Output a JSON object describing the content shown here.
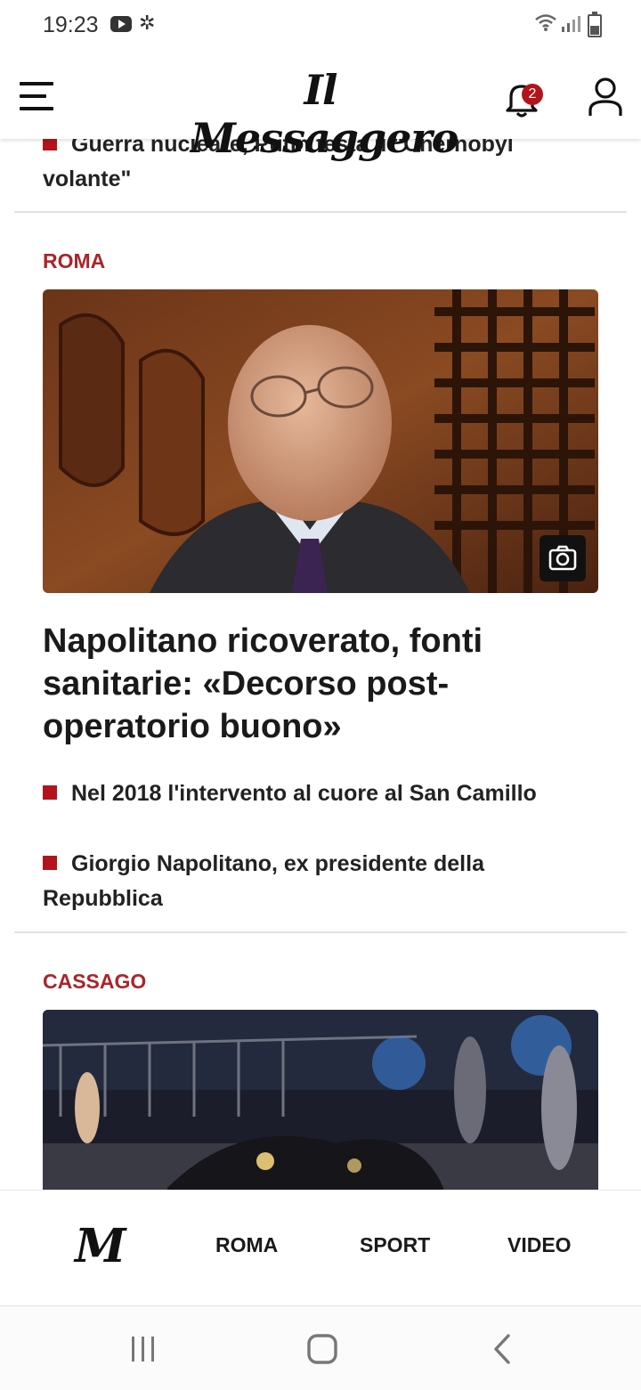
{
  "status_bar": {
    "time": "19:23"
  },
  "header": {
    "logo": "Il Messaggero",
    "notification_count": "2"
  },
  "articles": [
    {
      "bullets": [
        "Guerra nucleare, Putin testa il \"Chernobyl volante\""
      ]
    },
    {
      "section": "ROMA",
      "headline": "Napolitano ricoverato, fonti sanitarie: «Decorso post-operatorio buono»",
      "bullets": [
        "Nel 2018 l'intervento al cuore al San Camillo",
        "Giorgio Napolitano, ex presidente della Repubblica"
      ]
    },
    {
      "section": "CASSAGO"
    }
  ],
  "bottom_nav": {
    "logo": "M",
    "items": [
      "ROMA",
      "SPORT",
      "VIDEO"
    ]
  },
  "icons": {
    "menu": "menu-icon",
    "notifications": "bell-icon",
    "account": "user-icon",
    "gallery": "camera-icon"
  },
  "colors": {
    "accent": "#a9252b"
  }
}
